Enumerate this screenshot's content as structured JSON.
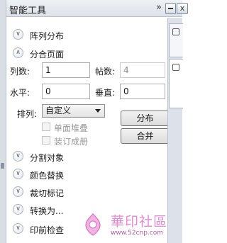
{
  "window": {
    "title": "智能工具",
    "collapse_glyph": "»",
    "close_glyph": "x"
  },
  "sections": {
    "array": {
      "label": "阵列分布",
      "state": "collapsed"
    },
    "nup": {
      "label": "分合页面",
      "state": "expanded"
    },
    "split": {
      "label": "分割对象"
    },
    "recolor": {
      "label": "颜色替换"
    },
    "cropmarks": {
      "label": "裁切标记"
    },
    "convert": {
      "label": "转换为..."
    },
    "preflight": {
      "label": "印前检查"
    }
  },
  "nup_form": {
    "columns_label": "列数:",
    "columns_value": "1",
    "frames_label": "帖数:",
    "frames_value": "4",
    "horizontal_label": "水平:",
    "horizontal_value": "0",
    "vertical_label": "垂直:",
    "vertical_value": "0",
    "arrange_label": "排列:",
    "arrange_value": "自定义",
    "single_stack_label": "单面堆叠",
    "bound_book_label": "装订成册",
    "distribute_button": "分布",
    "merge_button": "合并"
  },
  "watermark": {
    "text": "華印社區",
    "url": "www.52cnp.com"
  },
  "icons": {
    "collapse": "chevron-right-double-icon",
    "minimize": "minimize-icon",
    "close": "close-icon",
    "section_collapsed": "chevron-down-icon",
    "section_expanded": "chevron-up-icon"
  },
  "colors": {
    "titlebar": "#dde2e9",
    "rail": "#dde2ea",
    "watermark": "#e28ad0"
  }
}
